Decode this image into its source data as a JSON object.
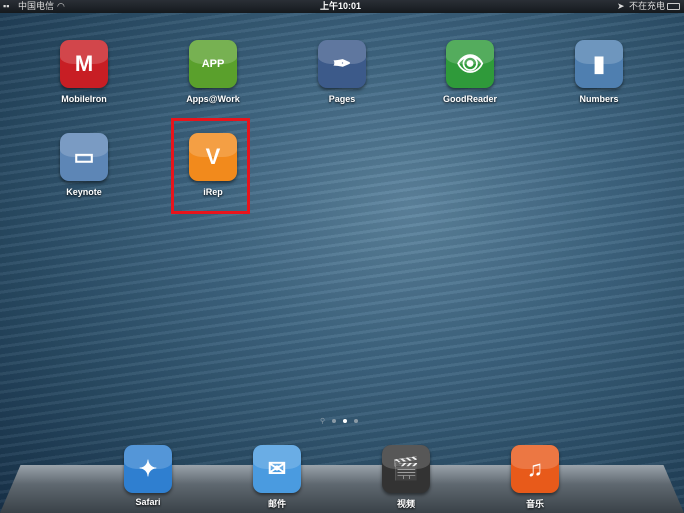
{
  "status_bar": {
    "carrier": "中国电信",
    "time": "上午10:01",
    "charging": "不在充电"
  },
  "apps": [
    {
      "label": "MobileIron",
      "icon": "mobileiron-icon",
      "color": "#c81e24"
    },
    {
      "label": "Apps@Work",
      "icon": "apps-at-work-icon",
      "color": "#5aa02c"
    },
    {
      "label": "Pages",
      "icon": "pages-icon",
      "color": "#3c5a8a"
    },
    {
      "label": "GoodReader",
      "icon": "goodreader-icon",
      "color": "#2f9a3a"
    },
    {
      "label": "Numbers",
      "icon": "numbers-icon",
      "color": "#4f7fb0"
    },
    {
      "label": "Keynote",
      "icon": "keynote-icon",
      "color": "#5d86b6"
    },
    {
      "label": "iRep",
      "icon": "irep-icon",
      "color": "#f28a1c"
    }
  ],
  "icon_glyphs": [
    "M",
    "APP",
    "✒",
    "👁",
    "▮",
    "▭",
    "V"
  ],
  "dock": [
    {
      "label": "Safari",
      "icon": "safari-icon",
      "color": "#2f7fd0",
      "glyph": "✦"
    },
    {
      "label": "邮件",
      "icon": "mail-icon",
      "color": "#4a9be0",
      "glyph": "✉"
    },
    {
      "label": "视频",
      "icon": "videos-icon",
      "color": "#333333",
      "glyph": "🎬"
    },
    {
      "label": "音乐",
      "icon": "music-icon",
      "color": "#e85a1a",
      "glyph": "♫"
    }
  ],
  "page_indicator": {
    "pages": 3,
    "current": 2
  },
  "highlight_color": "#e8141c"
}
